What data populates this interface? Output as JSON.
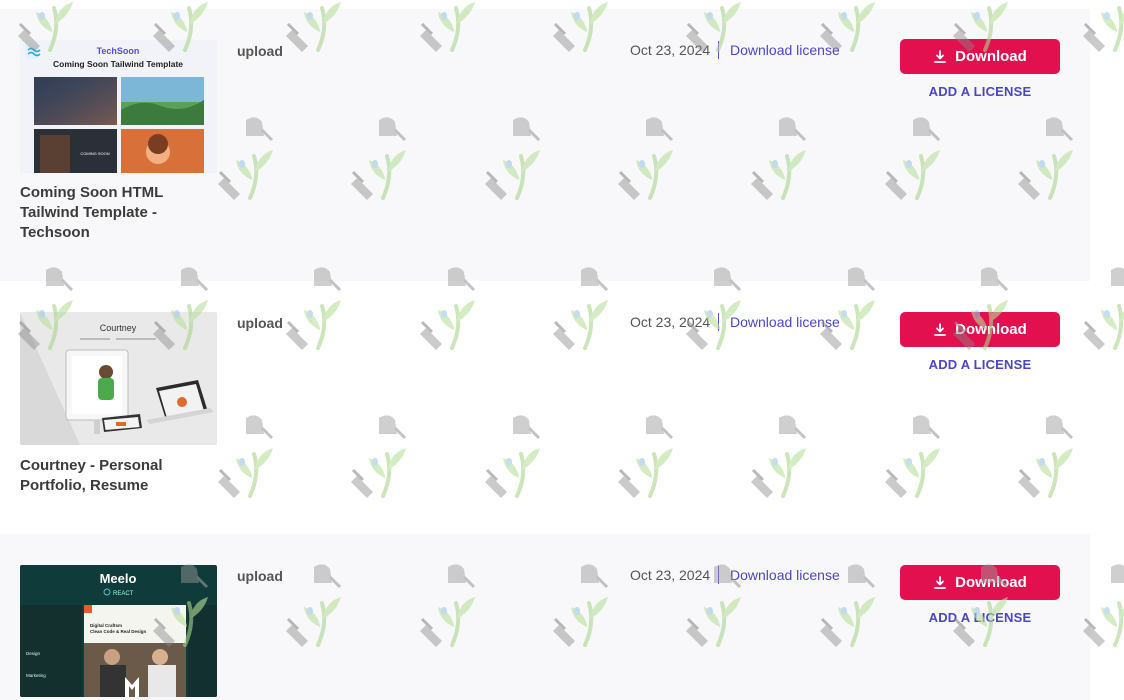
{
  "items": [
    {
      "title": "Coming Soon HTML Tailwind Template - Techsoon",
      "type": "upload",
      "date": "Oct 23, 2024",
      "license_link": "Download license",
      "download_label": "Download",
      "add_license_label": "ADD A LICENSE",
      "thumbnail": {
        "brand": "TechSoon",
        "heading": "Coming Soon Tailwind Template",
        "caption": "COMING SOON"
      }
    },
    {
      "title": "Courtney - Personal Portfolio, Resume",
      "type": "upload",
      "date": "Oct 23, 2024",
      "license_link": "Download license",
      "download_label": "Download",
      "add_license_label": "ADD A LICENSE",
      "thumbnail": {
        "brand": "Courtney"
      }
    },
    {
      "title": "",
      "type": "upload",
      "date": "Oct 23, 2024",
      "license_link": "Download license",
      "download_label": "Download",
      "add_license_label": "ADD A LICENSE",
      "thumbnail": {
        "brand": "Meelo",
        "sub": "REACT",
        "heading_1": "Digital Craftsm",
        "heading_2": "Clean Code & Real Design",
        "side_1": "Design",
        "side_2": "Marketing"
      }
    }
  ],
  "colors": {
    "download_button": "#e3104f",
    "link": "#4b46c9",
    "row_shade": "#f8f8fa"
  },
  "icons": {
    "download": "download-icon",
    "watermark": "watering-can-plant-watermark"
  }
}
